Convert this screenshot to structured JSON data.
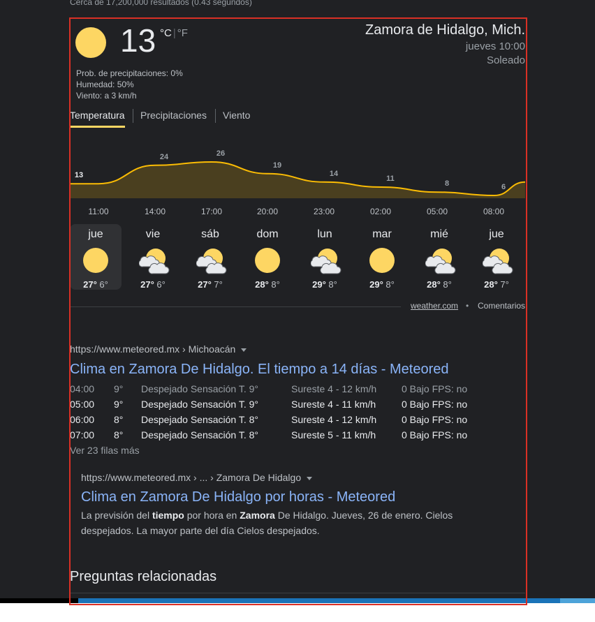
{
  "results_stats": "Cerca de 17,200,000 resultados (0.43 segundos)",
  "weather": {
    "current_temp": "13",
    "unit_c": "°C",
    "unit_sep": "|",
    "unit_f": "°F",
    "location": "Zamora de Hidalgo, Mich.",
    "datetime": "jueves 10:00",
    "condition": "Soleado",
    "precip": "Prob. de precipitaciones: 0%",
    "humidity": "Humedad: 50%",
    "wind": "Viento: a 3 km/h",
    "tabs": [
      "Temperatura",
      "Precipitaciones",
      "Viento"
    ],
    "active_tab": 0,
    "chart_data": {
      "type": "area",
      "series": [
        {
          "values": [
            13,
            24,
            26,
            19,
            14,
            11,
            8,
            6
          ]
        }
      ],
      "labels": [
        "13",
        "24",
        "26",
        "19",
        "14",
        "11",
        "8",
        "6"
      ],
      "categories": [
        "11:00",
        "14:00",
        "17:00",
        "20:00",
        "23:00",
        "02:00",
        "05:00",
        "08:00"
      ],
      "fill_color": "#4a3f1f",
      "line_color": "#fbbc04"
    },
    "days": [
      {
        "name": "jue",
        "icon": "sun-icon",
        "high": "27°",
        "low": "6°"
      },
      {
        "name": "vie",
        "icon": "partly-cloudy-icon",
        "high": "27°",
        "low": "6°"
      },
      {
        "name": "sáb",
        "icon": "partly-cloudy-icon",
        "high": "27°",
        "low": "7°"
      },
      {
        "name": "dom",
        "icon": "sun-icon",
        "high": "28°",
        "low": "8°"
      },
      {
        "name": "lun",
        "icon": "partly-cloudy-icon",
        "high": "29°",
        "low": "8°"
      },
      {
        "name": "mar",
        "icon": "sun-icon",
        "high": "29°",
        "low": "8°"
      },
      {
        "name": "mié",
        "icon": "partly-cloudy-icon",
        "high": "28°",
        "low": "8°"
      },
      {
        "name": "jue",
        "icon": "partly-cloudy-icon",
        "high": "28°",
        "low": "7°"
      }
    ],
    "selected_day": 0,
    "source": "weather.com",
    "dot": "•",
    "feedback": "Comentarios"
  },
  "result1": {
    "breadcrumb": "https://www.meteored.mx › Michoacán",
    "title": "Clima en Zamora De Hidalgo. El tiempo a 14 días - Meteored",
    "rows": [
      [
        "04:00",
        "9°",
        "Despejado Sensación T. 9°",
        "Sureste 4 - 12 km/h",
        "0 Bajo FPS: no"
      ],
      [
        "05:00",
        "9°",
        "Despejado Sensación T. 9°",
        "Sureste 4 - 11 km/h",
        "0 Bajo FPS: no"
      ],
      [
        "06:00",
        "8°",
        "Despejado Sensación T. 8°",
        "Sureste 4 - 12 km/h",
        "0 Bajo FPS: no"
      ],
      [
        "07:00",
        "8°",
        "Despejado Sensación T. 8°",
        "Sureste 5 - 11 km/h",
        "0 Bajo FPS: no"
      ]
    ],
    "more_rows": "Ver 23 filas más"
  },
  "result2": {
    "breadcrumb": "https://www.meteored.mx › ... › Zamora De Hidalgo",
    "title": "Clima en Zamora De Hidalgo por horas - Meteored",
    "snippet_parts": [
      "La previsión del ",
      "tiempo",
      " por hora en ",
      "Zamora",
      " De Hidalgo. Jueves, 26 de enero. Cielos despejados. La mayor parte del día Cielos despejados."
    ]
  },
  "related_heading": "Preguntas relacionadas",
  "colors": {
    "background": "#202124",
    "link": "#8ab4f8",
    "highlight_border": "#d93025",
    "sun": "#fdd663"
  }
}
